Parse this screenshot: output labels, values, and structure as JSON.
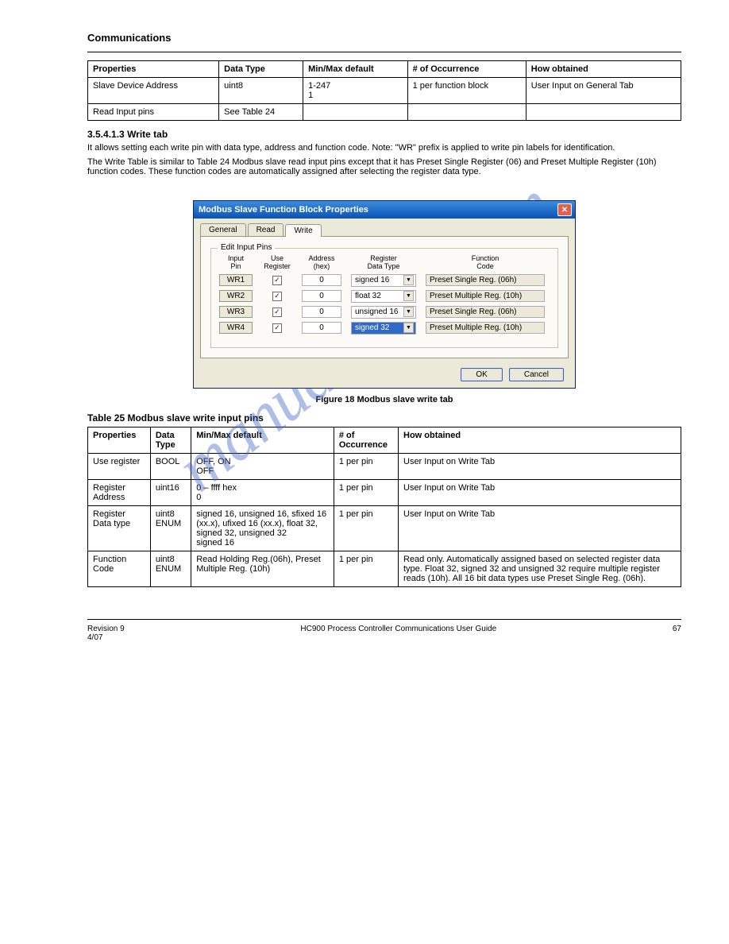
{
  "header": {
    "left": "Communications",
    "right": ""
  },
  "watermark": "manualshive.com",
  "table1": {
    "headers": [
      "Properties",
      "Data Type",
      "Min/Max default",
      "# of Occurrence",
      "How obtained"
    ],
    "rows": [
      {
        "prop": "Slave Device Address",
        "type": "uint8",
        "mm": "1-247\n1",
        "occ": "1 per function block",
        "how": "User Input on General Tab"
      },
      {
        "prop": "Read Input pins",
        "type": "See Table 24",
        "mm": "",
        "occ": "",
        "how": ""
      }
    ]
  },
  "section_num": "3.5.4.1.3",
  "section_title": "Write tab",
  "section_text1": "It allows setting each write pin with data type, address and function code. Note: \"WR\" prefix is applied to write pin labels for identification.",
  "section_text2": "The Write Table is similar to Table 24 Modbus slave read input pins except that it has Preset Single Register (06) and Preset Multiple Register (10h) function codes. These function codes are automatically assigned after selecting the register data type.",
  "dialog": {
    "title": "Modbus Slave Function Block Properties",
    "tabs": [
      "General",
      "Read",
      "Write"
    ],
    "active_tab": 2,
    "group_legend": "Edit Input Pins",
    "columns": [
      "Input\nPin",
      "Use\nRegister",
      "Address\n(hex)",
      "Register\nData Type",
      "Function\nCode"
    ],
    "rows": [
      {
        "pin": "WR1",
        "use": true,
        "addr": "0",
        "type": "signed 16",
        "selected": false,
        "func": "Preset Single Reg. (06h)"
      },
      {
        "pin": "WR2",
        "use": true,
        "addr": "0",
        "type": "float 32",
        "selected": false,
        "func": "Preset Multiple Reg. (10h)"
      },
      {
        "pin": "WR3",
        "use": true,
        "addr": "0",
        "type": "unsigned 16",
        "selected": false,
        "func": "Preset Single Reg. (06h)"
      },
      {
        "pin": "WR4",
        "use": true,
        "addr": "0",
        "type": "signed 32",
        "selected": true,
        "func": "Preset Multiple Reg. (10h)"
      }
    ],
    "ok": "OK",
    "cancel": "Cancel"
  },
  "figure_label": "Figure 18 Modbus slave write tab",
  "table2_title": "Table 25 Modbus slave write input pins",
  "table2": {
    "headers": [
      "Properties",
      "Data Type",
      "Min/Max default",
      "# of Occurrence",
      "How obtained"
    ],
    "rows": [
      {
        "prop": "Use register",
        "type": "BOOL",
        "mm": "OFF, ON\nOFF",
        "occ": "1 per pin",
        "how": "User Input on Write Tab"
      },
      {
        "prop": "Register Address",
        "type": "uint16",
        "mm": "0 – ffff hex\n0",
        "occ": "1 per pin",
        "how": "User Input on Write Tab"
      },
      {
        "prop": "Register Data type",
        "type": "uint8\nENUM",
        "mm": "signed 16, unsigned 16, sfixed 16 (xx.x), ufixed 16 (xx.x), float 32, signed 32, unsigned 32\nsigned 16",
        "occ": "1 per pin",
        "how": "User Input on Write Tab"
      },
      {
        "prop": "Function Code",
        "type": "uint8\nENUM",
        "mm": "Read Holding Reg.(06h), Preset Multiple Reg. (10h)",
        "occ": "1 per pin",
        "how": "Read only. Automatically assigned based on selected register data type. Float 32, signed 32 and unsigned 32 require multiple register reads (10h). All 16 bit data types use Preset Single Reg. (06h)."
      }
    ]
  },
  "footer": {
    "left": "Revision 9",
    "center": "HC900 Process Controller Communications User Guide",
    "right": "67",
    "date": "4/07"
  }
}
